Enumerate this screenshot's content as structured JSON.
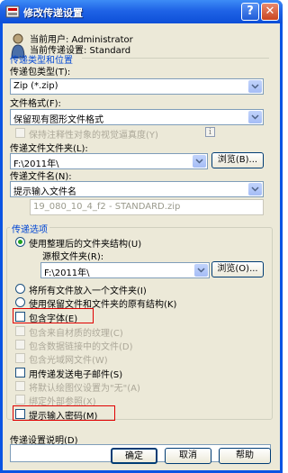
{
  "window": {
    "title": "修改传递设置",
    "help_label": "?",
    "close_label": "✕"
  },
  "header": {
    "current_user": "当前用户: Administrator",
    "current_setup": "当前传递设置: Standard"
  },
  "type_group": {
    "title": "传递类型和位置",
    "package_type_label": "传递包类型(T):",
    "package_type_value": "Zip (*.zip)",
    "file_format_label": "文件格式(F):",
    "file_format_value": "保留现有图形文件格式",
    "maintain_visual_fidelity": "保持注释性对象的视觉逼真度(Y)",
    "info_icon_glyph": "i",
    "folder_label": "传递文件文件夹(L):",
    "folder_value": "F:\\2011年\\",
    "browse_label": "浏览(B)...",
    "filename_label": "传递文件名(N):",
    "filename_value": "提示输入文件名",
    "filename_preview": "19_080_10_4_f2 - STANDARD.zip"
  },
  "options_group": {
    "title": "传递选项",
    "use_organized": "使用整理后的文件夹结构(U)",
    "source_root_label": "源根文件夹(R):",
    "source_root_value": "F:\\2011年\\",
    "browse_label": "浏览(O)...",
    "put_all_in_one": "将所有文件放入一个文件夹(I)",
    "keep_structure": "使用保留文件和文件夹的原有结构(K)",
    "include_fonts": "包含字体(E)",
    "include_textures": "包含来自材质的纹理(C)",
    "include_data_links": "包含数据链接中的文件(D)",
    "include_photometric": "包含光域网文件(W)",
    "send_email": "用传递发送电子邮件(S)",
    "set_plotter_none": "将默认绘图仪设置为\"无\"(A)",
    "bind_xrefs": "绑定外部参照(X)",
    "prompt_password": "提示输入密码(M)"
  },
  "description": {
    "label": "传递设置说明(D)",
    "value": ""
  },
  "buttons": {
    "ok": "确定",
    "cancel": "取消",
    "help": "帮助"
  },
  "colors": {
    "accent_blue": "#0046d5",
    "highlight_red": "#e00000",
    "radio_green": "#21a121"
  }
}
